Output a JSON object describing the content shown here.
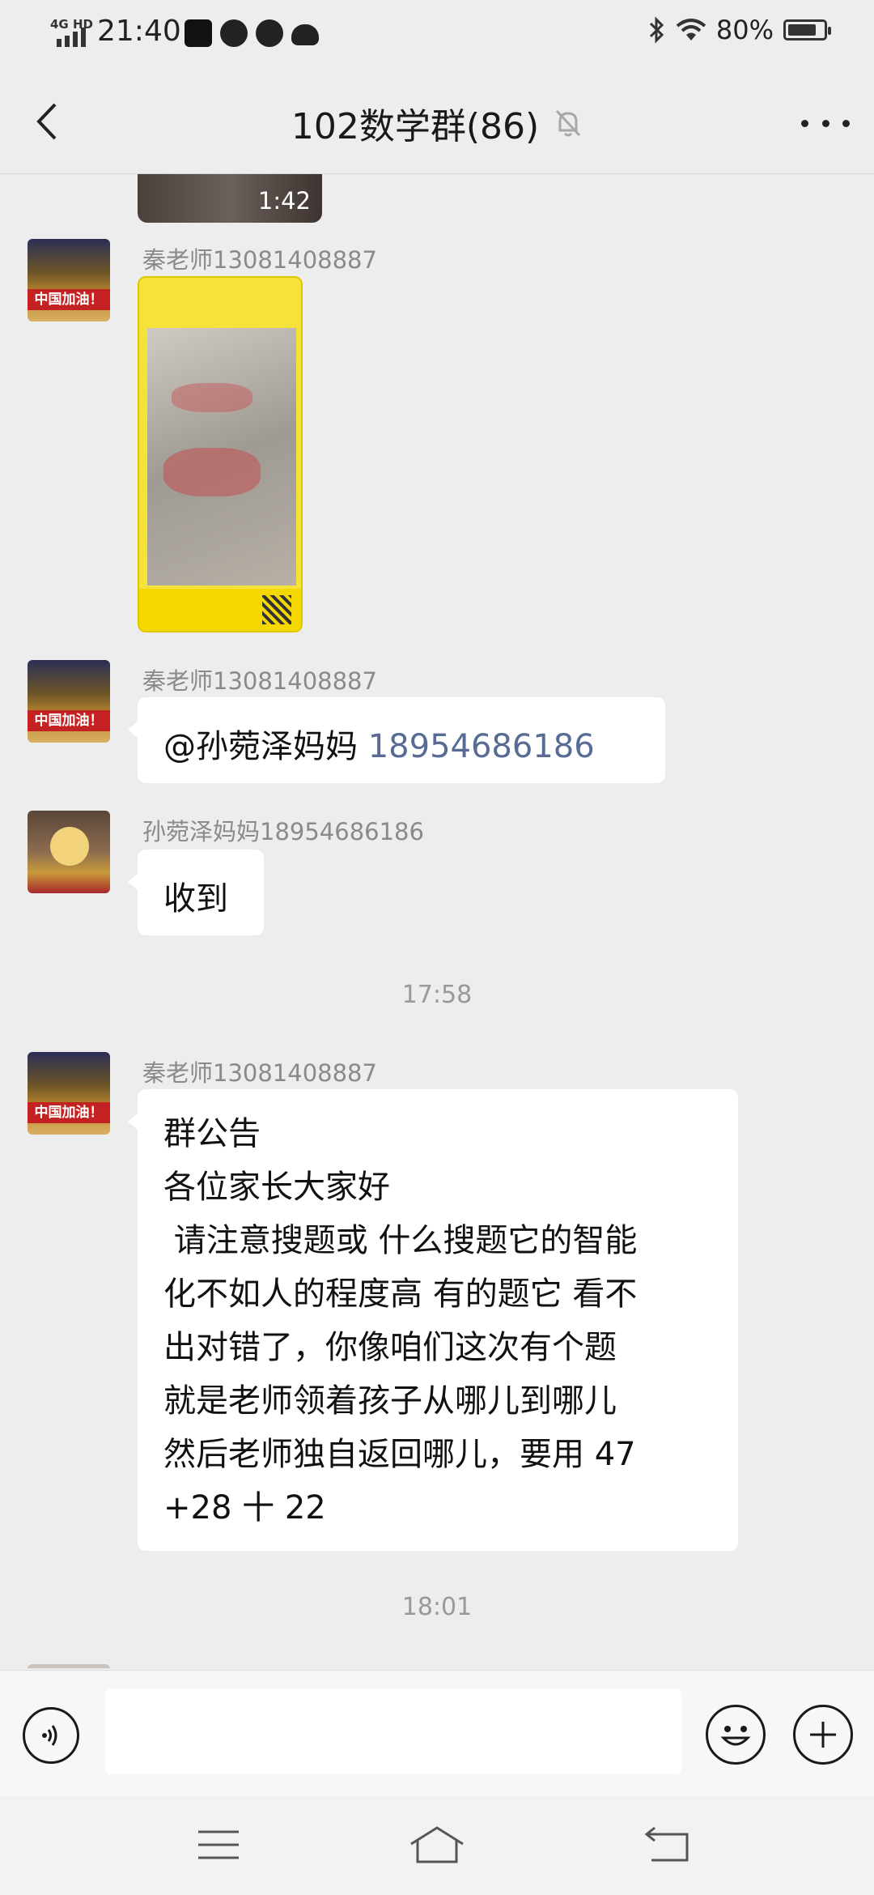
{
  "status_bar": {
    "network": "4G HD",
    "time": "21:40",
    "battery_percent": "80%",
    "battery_level": 0.8
  },
  "header": {
    "title": "102数学群(86)"
  },
  "messages": {
    "video": {
      "duration": "1:42"
    },
    "msg1": {
      "sender": "秦老师13081408887"
    },
    "msg2": {
      "sender": "秦老师13081408887",
      "mention": "@孙菀泽妈妈 ",
      "phone": "18954686186"
    },
    "msg3": {
      "sender": "孙菀泽妈妈18954686186",
      "text": "收到"
    },
    "time1": "17:58",
    "msg4": {
      "sender": "秦老师13081408887",
      "lines": [
        "群公告",
        "各位家长大家好",
        " 请注意搜题或 什么搜题它的智能",
        "化不如人的程度高 有的题它 看不",
        "出对错了，你像咱们这次有个题",
        "就是老师领着孩子从哪儿到哪儿",
        "然后老师独自返回哪儿，要用 47",
        "+28 十 22"
      ]
    },
    "time2": "18:01"
  },
  "avatar_labels": {
    "china_banner": "中国加油！"
  },
  "input": {
    "value": ""
  }
}
